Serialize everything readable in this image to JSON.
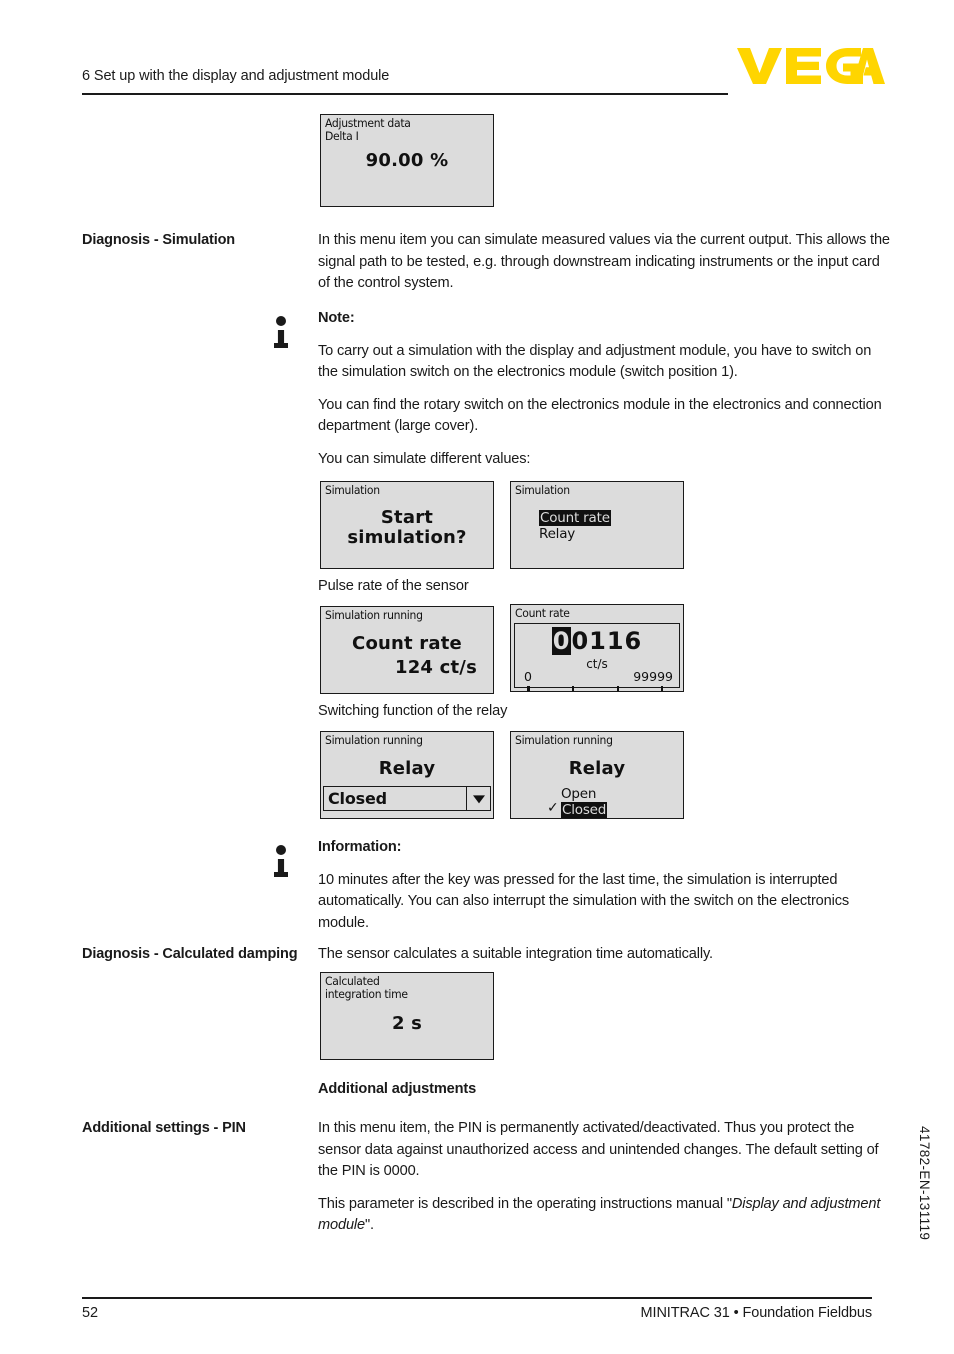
{
  "header": {
    "title": "6 Set up with the display and adjustment module",
    "logo_text": "VEGA",
    "logo_color": "#FFD500"
  },
  "displays": {
    "adjustment_data": {
      "title": "Adjustment data\nDelta I",
      "value": "90.00 %"
    },
    "start_simulation": {
      "title": "Simulation",
      "line1": "Start",
      "line2": "simulation?"
    },
    "simulation_menu": {
      "title": "Simulation",
      "items": [
        "Count rate",
        "Relay"
      ],
      "selected": "Count rate"
    },
    "simulation_running_count": {
      "title": "Simulation running",
      "line1": "Count rate",
      "line2": "124  ct/s"
    },
    "count_rate_editor": {
      "title": "Count rate",
      "digits_selected": "0",
      "digits_rest": "0116",
      "unit": "ct/s",
      "min": "0",
      "max": "99999"
    },
    "simulation_running_relay_combo": {
      "title": "Simulation running",
      "heading": "Relay",
      "value": "Closed"
    },
    "simulation_running_relay_list": {
      "title": "Simulation running",
      "heading": "Relay",
      "items": [
        "Open",
        "Closed"
      ],
      "selected": "Closed",
      "check_glyph": "✓"
    },
    "calculated_damping": {
      "title": "Calculated\nintegration time",
      "value": "2 s"
    }
  },
  "sections": {
    "diagnosis_simulation": {
      "label": "Diagnosis - Simulation",
      "paragraph": "In this menu item you can simulate measured values via the current output. This allows the signal path to be tested, e.g. through downstream indicating instruments or the input card of the control system."
    },
    "note": {
      "heading": "Note:",
      "p1": "To carry out a simulation with the display and adjustment module, you have to switch on the simulation switch on the electronics module (switch position 1).",
      "p2": "You can find the rotary switch on the electronics module in the electronics and connection department (large cover).",
      "p3": "You can simulate different values:"
    },
    "caption_pulse_rate": "Pulse rate of the sensor",
    "caption_switching_relay": "Switching function of the relay",
    "information": {
      "heading": "Information:",
      "p1": "10 minutes after the key was pressed for the last time, the simulation is interrupted automatically. You can also interrupt the simulation with the switch on the electronics module."
    },
    "diagnosis_damping": {
      "label": "Diagnosis - Calculated damping",
      "paragraph": "The sensor calculates a suitable integration time automatically."
    },
    "additional_adjustments_heading": "Additional adjustments",
    "additional_settings_pin": {
      "label": "Additional settings - PIN",
      "p1": "In this menu item, the PIN is permanently activated/deactivated. Thus you protect the sensor data against unauthorized access and unintended changes. The default setting of the PIN is 0000.",
      "p2_prefix": "This parameter is described in the operating instructions manual \"",
      "p2_italic": "Display and adjustment module",
      "p2_suffix": "\"."
    }
  },
  "doc_number": "41782-EN-131119",
  "footer": {
    "page": "52",
    "product": "MINITRAC 31 • Foundation Fieldbus"
  }
}
